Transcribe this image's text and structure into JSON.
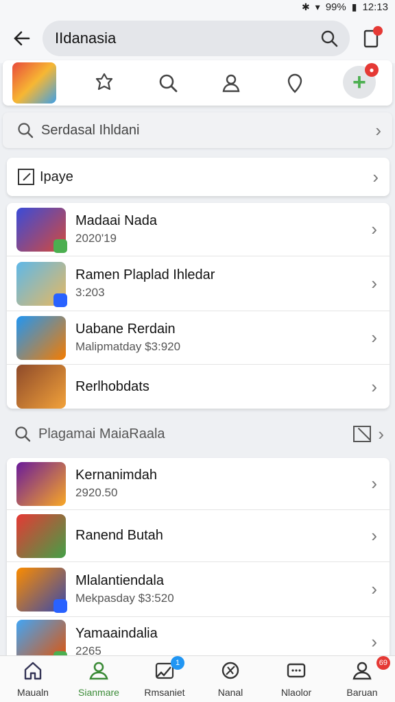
{
  "status": {
    "battery": "99%",
    "time": "12:13"
  },
  "search": {
    "value": "IIdanasia"
  },
  "section1": {
    "label": "Serdasal Ihldani"
  },
  "filter": {
    "label": "Ipaye"
  },
  "list1": [
    {
      "title": "Madaai Nada",
      "sub": "2020'19",
      "colors": [
        "#3a4bd8",
        "#d64a3a"
      ],
      "badge": "#4caf50"
    },
    {
      "title": "Ramen Plaplad Ihledar",
      "sub": "3:203",
      "colors": [
        "#5fb8e8",
        "#e8b85f"
      ],
      "badge": "#2962ff"
    },
    {
      "title": "Uabane Rerdain",
      "sub": "Malipmatday $3:920",
      "colors": [
        "#2196f3",
        "#f57c00"
      ],
      "badge": ""
    },
    {
      "title": "Rerlhobdats",
      "sub": "",
      "colors": [
        "#8e4a2a",
        "#f2a23a"
      ],
      "badge": ""
    }
  ],
  "section2": {
    "label": "Plagamai MaiaRaala"
  },
  "list2": [
    {
      "title": "Kernanimdah",
      "sub": "2920.50",
      "colors": [
        "#6a1b9a",
        "#f9a825"
      ],
      "badge": ""
    },
    {
      "title": "Ranend Butah",
      "sub": "",
      "colors": [
        "#e53935",
        "#43a047"
      ],
      "badge": ""
    },
    {
      "title": "Mlalantiendala",
      "sub": "Mekpasday $3:520",
      "colors": [
        "#fb8c00",
        "#3949ab"
      ],
      "badge": "#2962ff"
    },
    {
      "title": "Yamaaindalia",
      "sub": "2265",
      "colors": [
        "#42a5f5",
        "#e65100"
      ],
      "badge": "#4caf50"
    }
  ],
  "nav": [
    {
      "label": "Maualn",
      "active": false
    },
    {
      "label": "Sianmare",
      "active": true
    },
    {
      "label": "Rmsaniet",
      "active": false,
      "badge": "1"
    },
    {
      "label": "Nanal",
      "active": false
    },
    {
      "label": "Nlaolor",
      "active": false
    },
    {
      "label": "Baruan",
      "active": false,
      "badge": "69"
    }
  ]
}
